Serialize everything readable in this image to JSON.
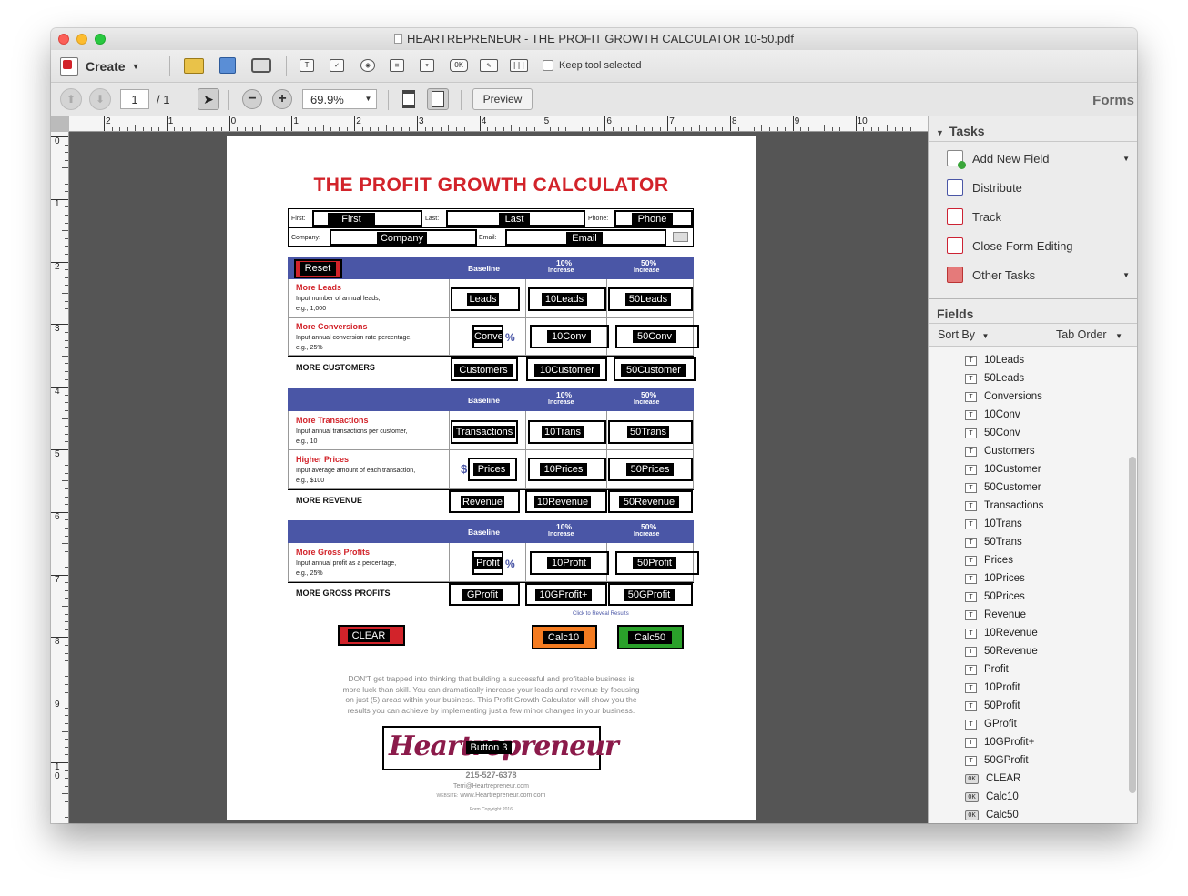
{
  "window": {
    "title": "HEARTREPRENEUR - THE PROFIT GROWTH CALCULATOR 10-50.pdf"
  },
  "toolbar": {
    "create_label": "Create",
    "keep_tool_label": "Keep tool selected",
    "page_current": "1",
    "page_total": "/ 1",
    "zoom": "69.9%",
    "preview_label": "Preview",
    "mode_label": "Forms"
  },
  "ruler": {
    "top_ticks": [
      "2",
      "1",
      "0",
      "1",
      "2",
      "3",
      "4",
      "5",
      "6",
      "7",
      "8",
      "9",
      "10"
    ],
    "left_ticks": [
      "0",
      "1",
      "2",
      "3",
      "4",
      "5",
      "6",
      "7",
      "8",
      "9",
      "1\n0"
    ]
  },
  "sidebar": {
    "tasks_header": "Tasks",
    "tasks": [
      {
        "label": "Add New Field",
        "icon": "add-field-icon",
        "has_menu": true
      },
      {
        "label": "Distribute",
        "icon": "distribute-icon",
        "has_menu": false
      },
      {
        "label": "Track",
        "icon": "track-icon",
        "has_menu": false
      },
      {
        "label": "Close Form Editing",
        "icon": "close-form-icon",
        "has_menu": false
      },
      {
        "label": "Other Tasks",
        "icon": "other-tasks-icon",
        "has_menu": true
      }
    ],
    "fields_header": "Fields",
    "sort_by_label": "Sort By",
    "tab_order_label": "Tab Order",
    "fields": [
      {
        "name": "10Leads",
        "type": "text"
      },
      {
        "name": "50Leads",
        "type": "text"
      },
      {
        "name": "Conversions",
        "type": "text"
      },
      {
        "name": "10Conv",
        "type": "text"
      },
      {
        "name": "50Conv",
        "type": "text"
      },
      {
        "name": "Customers",
        "type": "text"
      },
      {
        "name": "10Customer",
        "type": "text"
      },
      {
        "name": "50Customer",
        "type": "text"
      },
      {
        "name": "Transactions",
        "type": "text"
      },
      {
        "name": "10Trans",
        "type": "text"
      },
      {
        "name": "50Trans",
        "type": "text"
      },
      {
        "name": "Prices",
        "type": "text"
      },
      {
        "name": "10Prices",
        "type": "text"
      },
      {
        "name": "50Prices",
        "type": "text"
      },
      {
        "name": "Revenue",
        "type": "text"
      },
      {
        "name": "10Revenue",
        "type": "text"
      },
      {
        "name": "50Revenue",
        "type": "text"
      },
      {
        "name": "Profit",
        "type": "text"
      },
      {
        "name": "10Profit",
        "type": "text"
      },
      {
        "name": "50Profit",
        "type": "text"
      },
      {
        "name": "GProfit",
        "type": "text"
      },
      {
        "name": "10GProfit+",
        "type": "text"
      },
      {
        "name": "50GProfit",
        "type": "text"
      },
      {
        "name": "CLEAR",
        "type": "button"
      },
      {
        "name": "Calc10",
        "type": "button"
      },
      {
        "name": "Calc50",
        "type": "button"
      }
    ]
  },
  "document": {
    "title": "THE PROFIT GROWTH CALCULATOR",
    "contact": {
      "first_label": "First:",
      "first_field": "First",
      "last_label": "Last:",
      "last_field": "Last",
      "phone_label": "Phone:",
      "phone_field": "Phone",
      "company_label": "Company:",
      "company_field": "Company",
      "email_label": "Email:",
      "email_field": "Email"
    },
    "reset_button": "Reset",
    "col_baseline": "Baseline",
    "col_10": "10%",
    "col_50": "50%",
    "col_increase": "Increase",
    "sections": [
      {
        "rows": [
          {
            "title": "More Leads",
            "desc1": "Input number of annual leads,",
            "desc2": "e.g., 1,000",
            "fields": [
              "Leads",
              "10Leads",
              "50Leads"
            ],
            "suffix": ""
          },
          {
            "title": "More Conversions",
            "desc1": "Input annual conversion rate percentage,",
            "desc2": "e.g., 25%",
            "fields": [
              "Conve",
              "10Conv",
              "50Conv"
            ],
            "suffix": "%"
          }
        ],
        "total_label": "MORE CUSTOMERS",
        "total_fields": [
          "Customers",
          "10Customer",
          "50Customer"
        ]
      },
      {
        "rows": [
          {
            "title": "More Transactions",
            "desc1": "Input annual transactions per customer,",
            "desc2": "e.g., 10",
            "fields": [
              "Transactions",
              "10Trans",
              "50Trans"
            ],
            "suffix": ""
          },
          {
            "title": "Higher Prices",
            "desc1": "Input average amount of each transaction,",
            "desc2": "e.g., $100",
            "fields": [
              "Prices",
              "10Prices",
              "50Prices"
            ],
            "prefix": "$"
          }
        ],
        "total_label": "MORE REVENUE",
        "total_fields": [
          "Revenue",
          "10Revenue",
          "50Revenue"
        ]
      },
      {
        "rows": [
          {
            "title": "More Gross Profits",
            "desc1": "Input annual profit as a percentage,",
            "desc2": "e.g., 25%",
            "fields": [
              "Profit",
              "10Profit",
              "50Profit"
            ],
            "suffix": "%"
          }
        ],
        "total_label": "MORE GROSS PROFITS",
        "total_fields": [
          "GProfit",
          "10GProfit+",
          "50GProfit"
        ]
      }
    ],
    "reveal_note": "Click to Reveal Results",
    "clear_button": "CLEAR",
    "calc10_button": "Calc10",
    "calc50_button": "Calc50",
    "paragraph": [
      "DON'T get trapped into thinking that building a successful and profitable business is",
      "more luck than skill. You can dramatically increase your leads and revenue by focusing",
      "on just (5) areas within your business. This Profit Growth Calculator will show you the",
      "results you can achieve by implementing just a few minor changes in your business."
    ],
    "logo_text": "Heartrepreneur",
    "logo_button": "Button 3",
    "phone": "215-527-6378",
    "email": "Terri@Heartrepreneur.com",
    "website_label": "WEBSITE:",
    "website": "www.Heartrepreneur.com.com",
    "copyright": "Form Copyright 2016"
  },
  "colors": {
    "title_red": "#d2232a",
    "header_blue": "#4a56a6",
    "calc10_orange": "#f47b20",
    "calc50_green": "#2aa02a",
    "clear_red": "#d2232a"
  }
}
